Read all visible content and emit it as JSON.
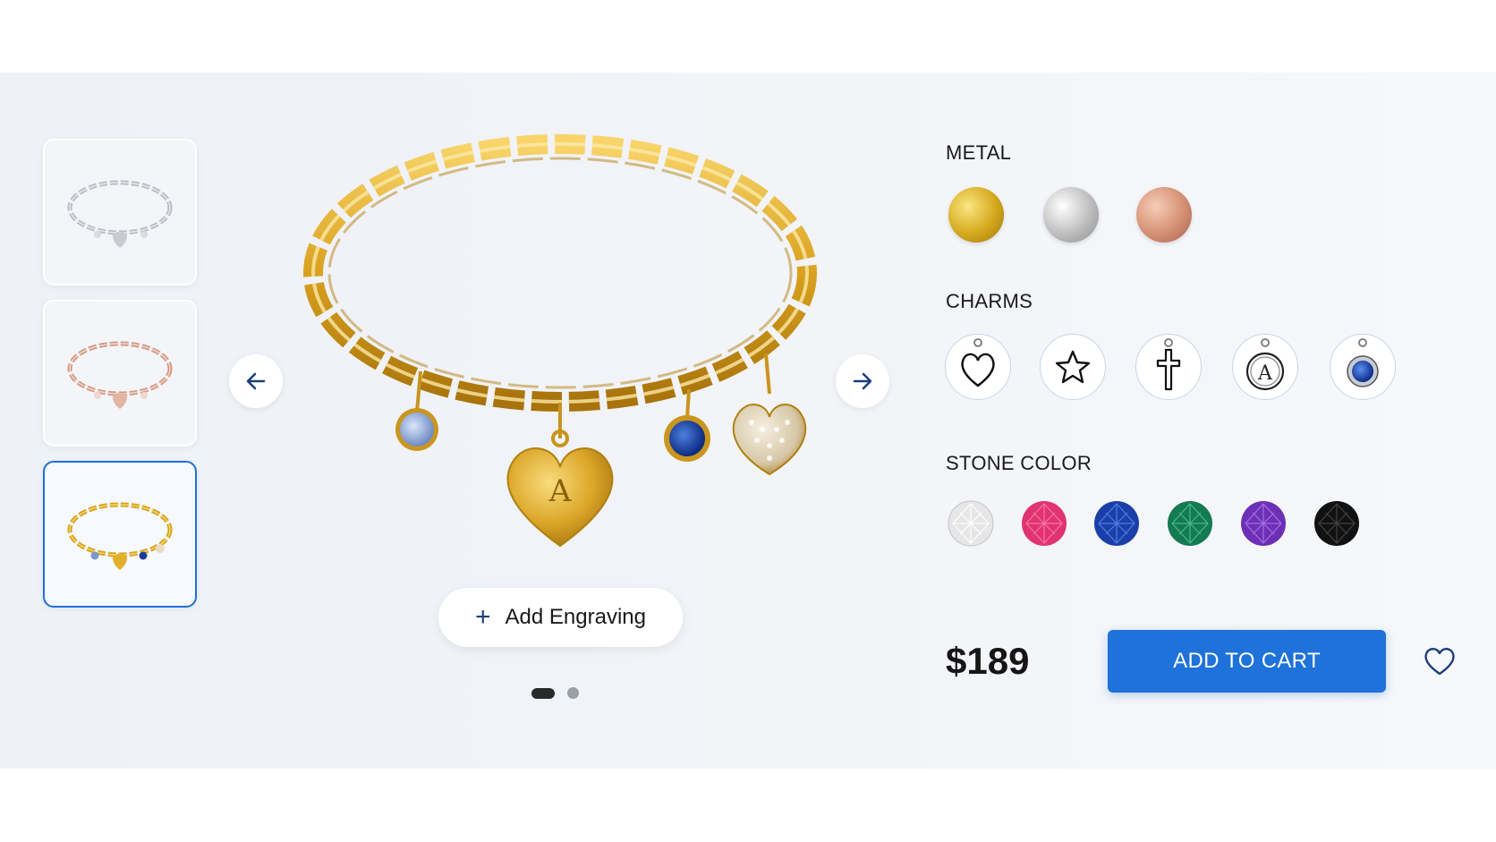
{
  "gallery": {
    "thumbnails": [
      {
        "label": "silver-bracelet-thumbnail",
        "metal": "silver",
        "selected": false
      },
      {
        "label": "rose-gold-bracelet-thumbnail",
        "metal": "rose gold",
        "selected": false
      },
      {
        "label": "gold-bracelet-thumbnail",
        "metal": "gold",
        "selected": true
      }
    ],
    "main_image_engraving_letter": "A",
    "engrave_button": "Add Engraving",
    "carousel": {
      "current_page": 1,
      "total_pages": 2
    }
  },
  "options": {
    "metal": {
      "label": "METAL",
      "swatches": [
        {
          "name": "gold",
          "color": "#d4a81c"
        },
        {
          "name": "silver",
          "color": "#bdbdbd"
        },
        {
          "name": "rose gold",
          "color": "#d48f73"
        }
      ]
    },
    "charms": {
      "label": "CHARMS",
      "items": [
        {
          "name": "heart-charm",
          "glyph": "heart"
        },
        {
          "name": "star-charm",
          "glyph": "star"
        },
        {
          "name": "cross-charm",
          "glyph": "cross"
        },
        {
          "name": "letter-charm",
          "glyph": "letter",
          "letter": "A"
        },
        {
          "name": "birthstone-charm",
          "glyph": "stone"
        }
      ]
    },
    "stone_color": {
      "label": "STONE COLOR",
      "stones": [
        {
          "name": "clear",
          "color": "#e6e6e6"
        },
        {
          "name": "pink",
          "color": "#e0336f"
        },
        {
          "name": "blue",
          "color": "#1a3fa8"
        },
        {
          "name": "green",
          "color": "#137a52"
        },
        {
          "name": "purple",
          "color": "#6c2fb5"
        },
        {
          "name": "black",
          "color": "#111111"
        }
      ]
    }
  },
  "purchase": {
    "price": "$189",
    "add_to_cart": "ADD TO CART"
  },
  "colors": {
    "accent": "#1e72d9",
    "nav_arrow": "#1c3f7a"
  }
}
